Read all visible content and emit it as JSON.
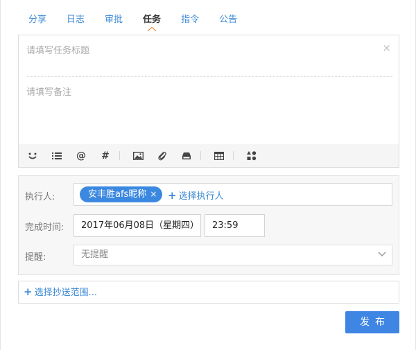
{
  "tabs": [
    {
      "label": "分享"
    },
    {
      "label": "日志"
    },
    {
      "label": "审批"
    },
    {
      "label": "任务",
      "active": true
    },
    {
      "label": "指令"
    },
    {
      "label": "公告"
    }
  ],
  "compose": {
    "title_placeholder": "请填写任务标题",
    "close_symbol": "×",
    "note_placeholder": "请填写备注",
    "toolbar": {
      "mention_symbol": "@",
      "topic_symbol": "#"
    }
  },
  "form": {
    "executor_label": "执行人:",
    "executor_chip": "安丰胜afs昵称",
    "chip_remove": "×",
    "add_executor": "选择执行人",
    "deadline_label": "完成时间:",
    "date_value": "2017年06月08日（星期四）",
    "time_value": "23:59",
    "remind_label": "提醒:",
    "remind_value": "无提醒"
  },
  "cc": {
    "label": "选择抄送范围..."
  },
  "publish_label": "发布",
  "plus_symbol": "+",
  "colors": {
    "accent": "#3b89d6",
    "chip": "#3b88e0",
    "publish": "#3f86e4",
    "active_tab_caret": "#f08a3c"
  }
}
